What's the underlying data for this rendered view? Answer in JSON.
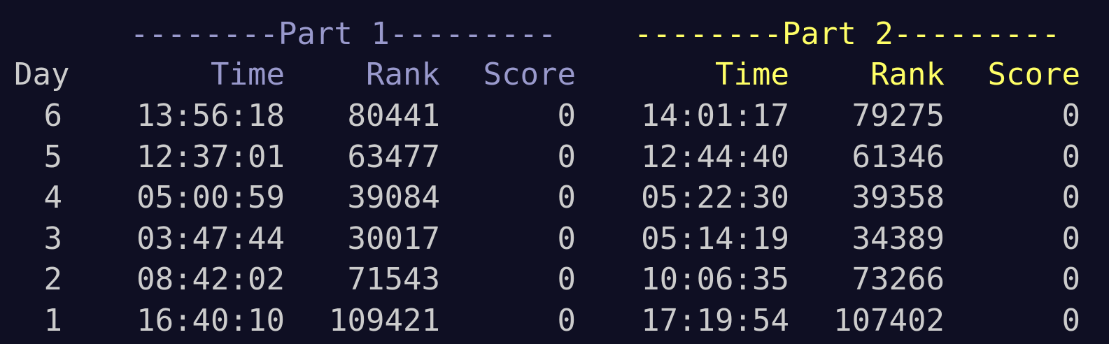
{
  "colors": {
    "background": "#0f0f23",
    "text": "#cccccc",
    "part1": "#9999cc",
    "part2": "#ffff66"
  },
  "headers": {
    "part1_banner": "--------Part 1---------",
    "part2_banner": "--------Part 2---------",
    "day": "Day",
    "time": "Time",
    "rank": "Rank",
    "score": "Score"
  },
  "rows": [
    {
      "day": "6",
      "p1_time": "13:56:18",
      "p1_rank": "80441",
      "p1_score": "0",
      "p2_time": "14:01:17",
      "p2_rank": "79275",
      "p2_score": "0"
    },
    {
      "day": "5",
      "p1_time": "12:37:01",
      "p1_rank": "63477",
      "p1_score": "0",
      "p2_time": "12:44:40",
      "p2_rank": "61346",
      "p2_score": "0"
    },
    {
      "day": "4",
      "p1_time": "05:00:59",
      "p1_rank": "39084",
      "p1_score": "0",
      "p2_time": "05:22:30",
      "p2_rank": "39358",
      "p2_score": "0"
    },
    {
      "day": "3",
      "p1_time": "03:47:44",
      "p1_rank": "30017",
      "p1_score": "0",
      "p2_time": "05:14:19",
      "p2_rank": "34389",
      "p2_score": "0"
    },
    {
      "day": "2",
      "p1_time": "08:42:02",
      "p1_rank": "71543",
      "p1_score": "0",
      "p2_time": "10:06:35",
      "p2_rank": "73266",
      "p2_score": "0"
    },
    {
      "day": "1",
      "p1_time": "16:40:10",
      "p1_rank": "109421",
      "p1_score": "0",
      "p2_time": "17:19:54",
      "p2_rank": "107402",
      "p2_score": "0"
    }
  ]
}
